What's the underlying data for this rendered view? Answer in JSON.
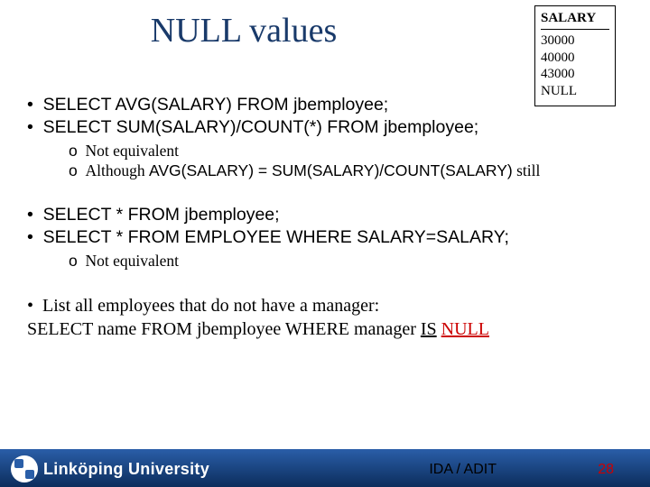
{
  "title": "NULL values",
  "salary_table": {
    "header": "SALARY",
    "rows": [
      "30000",
      "40000",
      "43000",
      "NULL"
    ]
  },
  "bullets": {
    "q1": "SELECT AVG(SALARY) FROM jbemployee;",
    "q2": "SELECT SUM(SALARY)/COUNT(*) FROM jbemployee;",
    "sub1a": "Not equivalent",
    "sub1b_pre": "Although ",
    "sub1b_mono": "AVG(SALARY)  = SUM(SALARY)/COUNT(SALARY)",
    "sub1b_post": " still",
    "q3": "SELECT * FROM jbemployee;",
    "q4": "SELECT * FROM EMPLOYEE WHERE SALARY=SALARY;",
    "sub2a": "Not equivalent",
    "q5": "List all employees that do not have a manager:",
    "q6_pre": "SELECT name FROM jbemployee WHERE manager ",
    "q6_is": "IS",
    "q6_null": "NULL"
  },
  "footer": {
    "org": "IDA / ADIT",
    "page": "28",
    "uni": "Linköping University"
  }
}
